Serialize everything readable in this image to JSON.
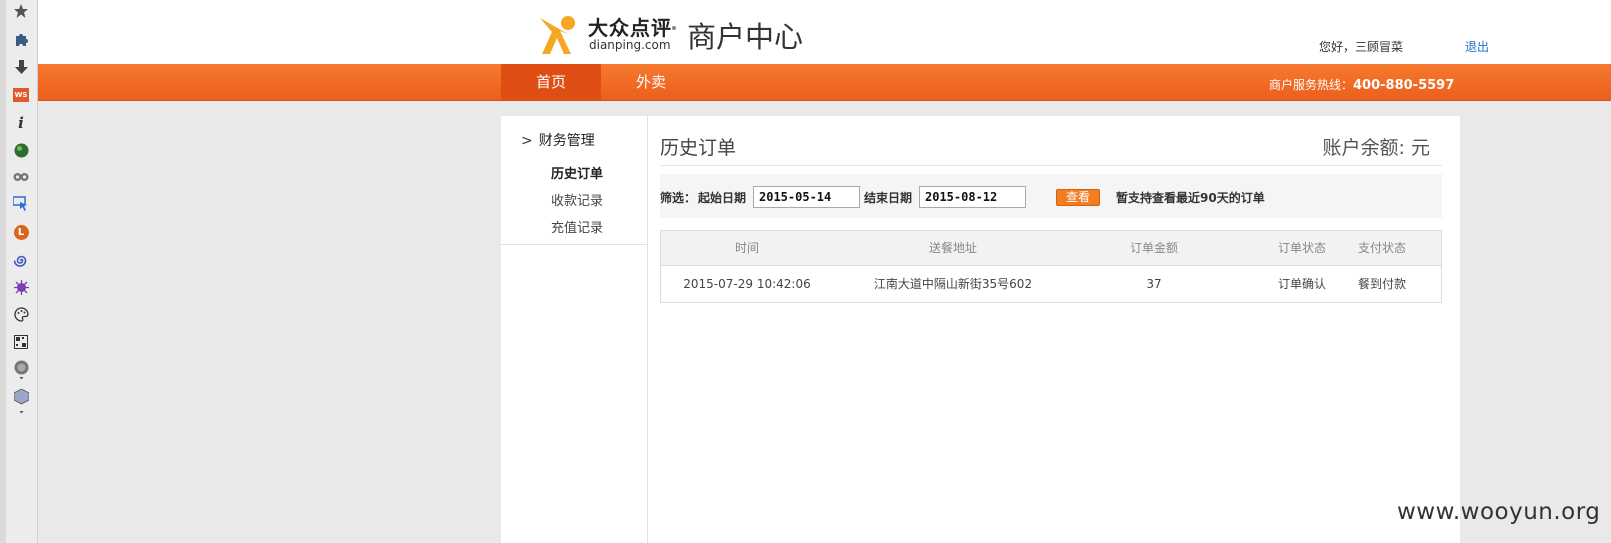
{
  "toolbar": {
    "icons": [
      "star-icon",
      "puzzle-icon",
      "download-arrow-icon",
      "ws-icon",
      "info-icon",
      "green-ball-icon",
      "eyes-icon",
      "cursor-icon",
      "l-badge-icon",
      "spiral-icon",
      "splat-icon",
      "palette-icon",
      "qr-icon",
      "globe-icon",
      "cube-icon"
    ],
    "ws_label": "WS",
    "info_glyph": "i",
    "l_glyph": "L"
  },
  "header": {
    "brand_cn": "大众点评",
    "brand_en": "dianping.com",
    "center_title": "商户中心",
    "greeting": "您好，三顾冒菜",
    "logout": "退出"
  },
  "nav": {
    "items": [
      "首页",
      "外卖"
    ],
    "hotline_label": "商户服务热线：",
    "hotline_number": "400-880-5597"
  },
  "sidebar": {
    "section": "财务管理",
    "section_arrow": ">",
    "items": [
      "历史订单",
      "收款记录",
      "充值记录"
    ]
  },
  "main": {
    "title": "历史订单",
    "balance": "账户余额: 元",
    "filter": {
      "label": "筛选：",
      "start_label": "起始日期",
      "start_value": "2015-05-14",
      "end_label": "结束日期",
      "end_value": "2015-08-12",
      "button": "查看",
      "note": "暂支持查看最近90天的订单"
    },
    "table": {
      "headers": [
        "时间",
        "送餐地址",
        "订单金额",
        "订单状态",
        "支付状态"
      ],
      "rows": [
        [
          "2015-07-29 10:42:06",
          "江南大道中隔山新街35号602",
          "37",
          "订单确认",
          "餐到付款"
        ]
      ]
    }
  },
  "watermark": "www.wooyun.org",
  "colors": {
    "nav_orange": "#ec5f1c",
    "nav_active": "#df4f14",
    "button_orange": "#f17e22",
    "link_blue": "#1a73c8",
    "logo_orange": "#f5a623"
  }
}
